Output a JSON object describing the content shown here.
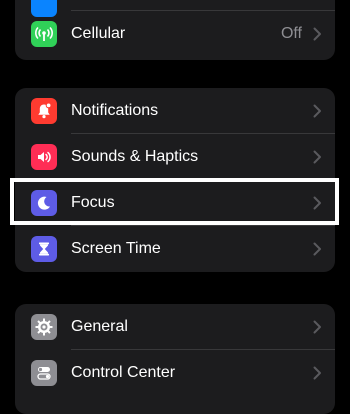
{
  "groups": [
    {
      "items": [
        {
          "label": "",
          "icon": "network-icon",
          "color": "#0a84ff"
        },
        {
          "label": "Cellular",
          "value": "Off",
          "icon": "antenna-icon",
          "color": "#30d158"
        }
      ]
    },
    {
      "items": [
        {
          "label": "Notifications",
          "icon": "bell-icon",
          "color": "#ff3b30"
        },
        {
          "label": "Sounds & Haptics",
          "icon": "speaker-icon",
          "color": "#ff2d55"
        },
        {
          "label": "Focus",
          "icon": "moon-icon",
          "color": "#5e5ce6",
          "highlighted": true
        },
        {
          "label": "Screen Time",
          "icon": "hourglass-icon",
          "color": "#5e5ce6"
        }
      ]
    },
    {
      "items": [
        {
          "label": "General",
          "icon": "gear-icon",
          "color": "#8e8e93"
        },
        {
          "label": "Control Center",
          "icon": "toggles-icon",
          "color": "#8e8e93"
        }
      ]
    }
  ],
  "colors": {
    "background": "#000000",
    "cell": "#1c1c1e",
    "separator": "#38383a",
    "highlight_border": "#ffffff"
  }
}
